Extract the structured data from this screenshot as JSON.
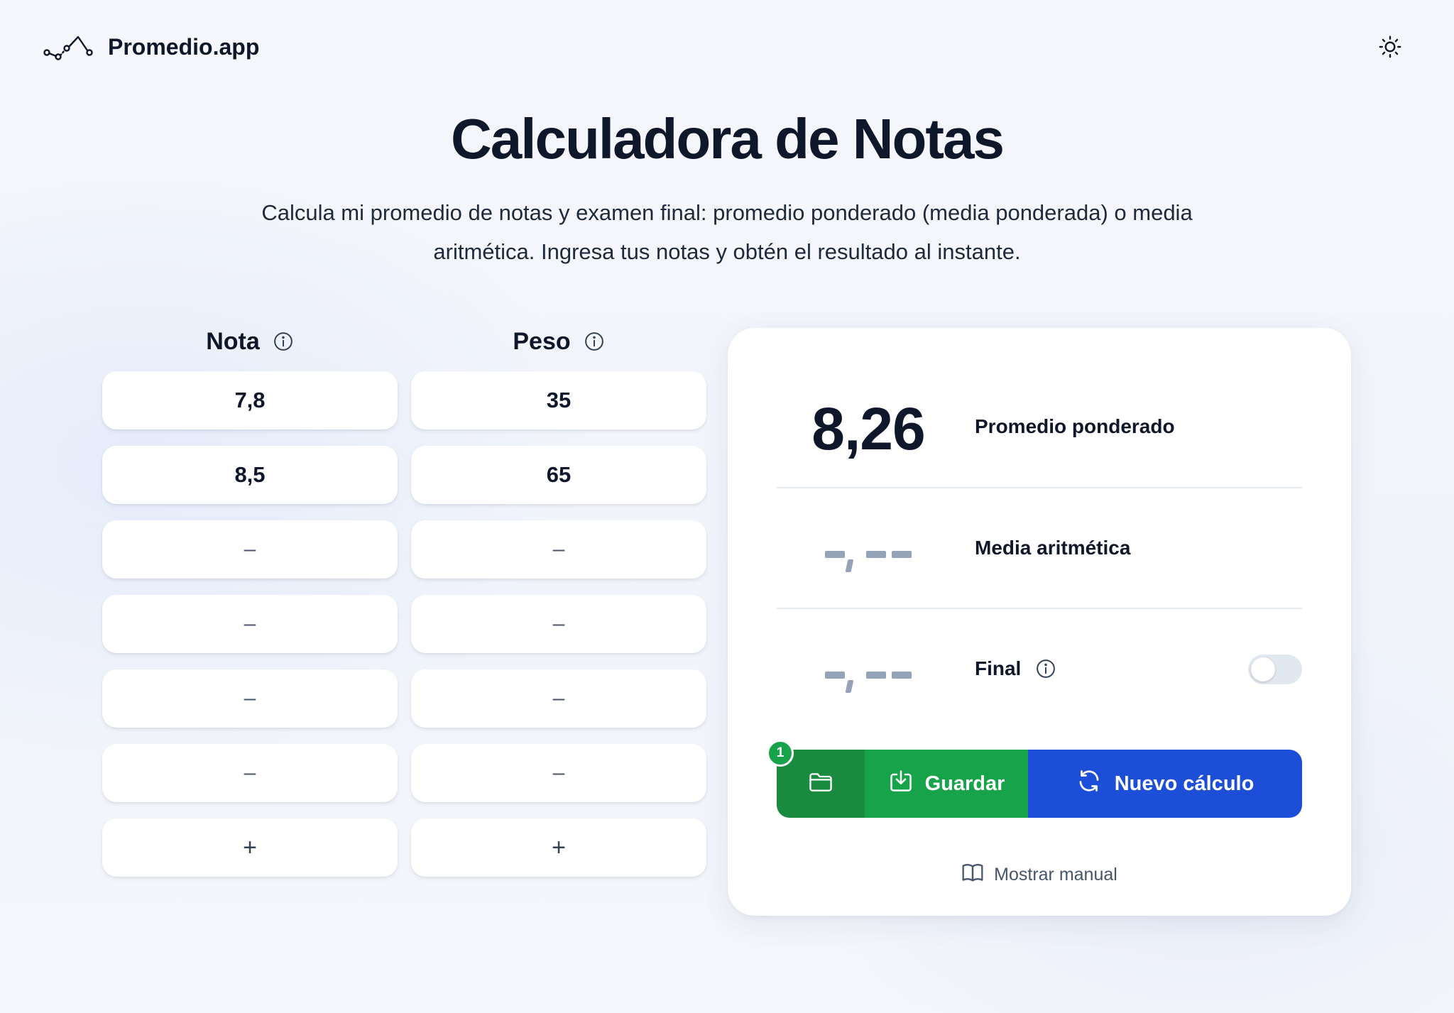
{
  "header": {
    "brand_name": "Promedio.app",
    "logo_icon": "chart-line-icon",
    "theme_icon": "sun-icon"
  },
  "hero": {
    "title": "Calculadora de Notas",
    "subtitle_line1": "Calcula mi promedio de notas y examen final: promedio ponderado (media ponderada) o media",
    "subtitle_line2": "aritmética. Ingresa tus notas y obtén el resultado al instante."
  },
  "inputs": {
    "nota_header": "Nota",
    "peso_header": "Peso",
    "placeholder": "–",
    "add_label": "+",
    "rows": [
      {
        "nota": "7,8",
        "peso": "35"
      },
      {
        "nota": "8,5",
        "peso": "65"
      },
      {
        "nota": "",
        "peso": ""
      },
      {
        "nota": "",
        "peso": ""
      },
      {
        "nota": "",
        "peso": ""
      },
      {
        "nota": "",
        "peso": ""
      }
    ]
  },
  "results": {
    "weighted_value": "8,26",
    "weighted_label": "Promedio ponderado",
    "arithmetic_value": "-,--",
    "arithmetic_label": "Media aritmética",
    "final_value": "-,--",
    "final_label": "Final",
    "final_toggle_on": false
  },
  "actions": {
    "saved_count": "1",
    "save_label": "Guardar",
    "new_label": "Nuevo cálculo",
    "manual_label": "Mostrar manual"
  },
  "colors": {
    "green_dark": "#1a8a3f",
    "green": "#16a34a",
    "blue": "#1d4ed8",
    "placeholder_gray": "#94a3b8"
  }
}
